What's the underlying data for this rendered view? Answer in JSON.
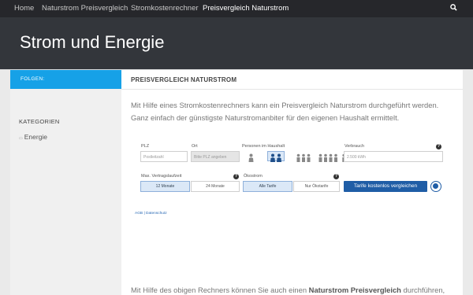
{
  "nav": {
    "items": [
      "Home",
      "Naturstrom Preisvergleich",
      "Stromkostenrechner",
      "Preisvergleich Naturstrom"
    ],
    "active_index": 3,
    "search_icon": "search-icon"
  },
  "header": {
    "site_title": "Strom und Energie"
  },
  "sidebar": {
    "follow_label": "FOLGEN:",
    "categories_heading": "KATEGORIEN",
    "categories": [
      "Energie"
    ]
  },
  "content": {
    "title": "PREISVERGLEICH NATURSTROM",
    "intro": "Mit Hilfe eines Stromkostenrechners kann ein Preisvergleich Naturstrom durchgeführt werden. Ganz einfach der günstigste Naturstromanbiter für den eigenen Haushalt ermittelt.",
    "bottom_before": "Mit Hilfe des obigen Rechners können Sie auch einen ",
    "bottom_bold": "Naturstrom Preisvergleich",
    "bottom_after": " durchführen,"
  },
  "calculator": {
    "plz_label": "PLZ",
    "plz_placeholder": "Postleitzahl",
    "ort_label": "Ort",
    "ort_placeholder": "Bitte PLZ angeben",
    "persons_label": "Personen im Haushalt",
    "persons_selected": 2,
    "consumption_label": "Verbrauch",
    "consumption_value": "2.500 kWh",
    "term_label": "Max. Vertragslaufzeit",
    "term_options": [
      "12 Monate",
      "24 Monate"
    ],
    "term_selected": 0,
    "eco_label": "Ökostrom",
    "eco_options": [
      "Alle Tarife",
      "Nur Ökotarife"
    ],
    "eco_selected": 0,
    "compare_button": "Tarife kostenlos vergleichen",
    "help_glyph": "?",
    "footer_links": "AGB | Datenschutz",
    "colors": {
      "accent": "#1f5da6",
      "nav_bg": "#26272b",
      "header_bg": "#33363b",
      "follow_bg": "#16a1e7"
    }
  }
}
